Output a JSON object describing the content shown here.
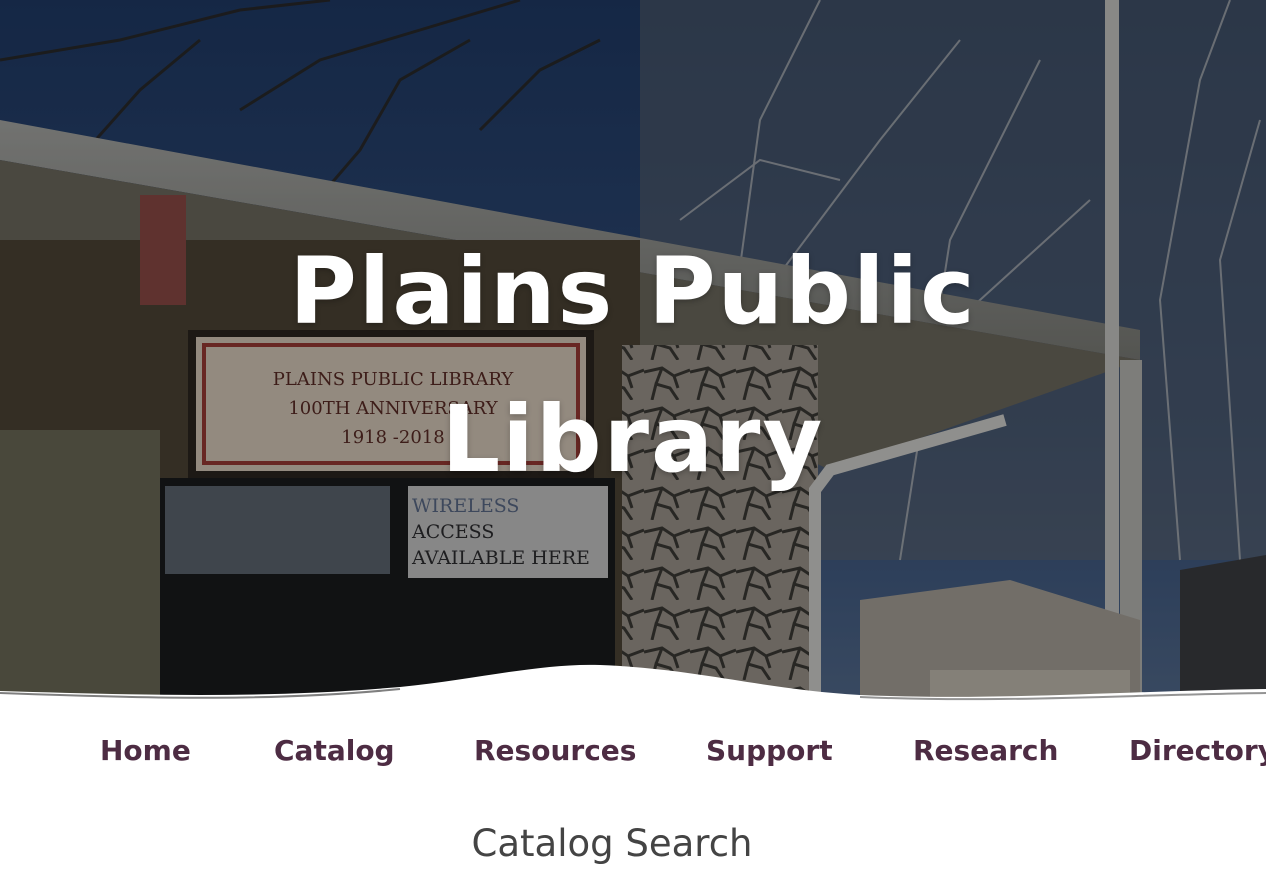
{
  "hero": {
    "title_line_1": "Plains Public",
    "title_line_2": "Library",
    "sign_text": [
      "PLAINS PUBLIC LIBRARY",
      "100TH ANNIVERSARY",
      "1918 -2018"
    ],
    "window_text": [
      "WIRELESS",
      "ACCESS",
      "AVAILABLE HERE"
    ]
  },
  "nav": {
    "items": [
      {
        "label": "Home"
      },
      {
        "label": "Catalog"
      },
      {
        "label": "Resources"
      },
      {
        "label": "Support"
      },
      {
        "label": "Research"
      },
      {
        "label": "Directory"
      }
    ]
  },
  "main": {
    "section_title": "Catalog Search"
  },
  "colors": {
    "nav_text": "#4d2c43",
    "title_text": "#444444",
    "hero_overlay": "#000000"
  }
}
